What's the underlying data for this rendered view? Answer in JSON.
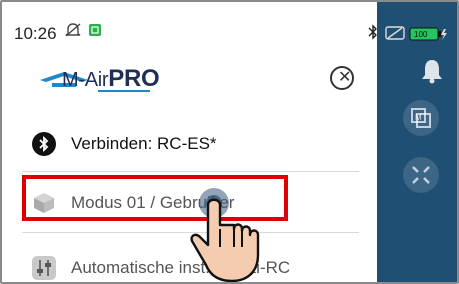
{
  "status_bar": {
    "time": "10:26"
  },
  "drawer": {
    "logo": {
      "brand": "M-Air",
      "suffix": "PRO"
    },
    "items": [
      {
        "label": "Verbinden: RC-ES*",
        "icon": "bluetooth-icon"
      },
      {
        "label": "Modus 01 / Gebruiker",
        "icon": "cube-icon"
      },
      {
        "label": "Automatische inst... Multi-RC",
        "icon": "sliders-icon"
      }
    ]
  },
  "side_panel": {
    "icons": [
      "bell-icon",
      "m-square-icon",
      "expand-icon"
    ]
  },
  "colors": {
    "side_panel": "#1f4f73",
    "highlight": "#e00000",
    "brand": "#1f2f55",
    "battery": "#22c55e"
  }
}
